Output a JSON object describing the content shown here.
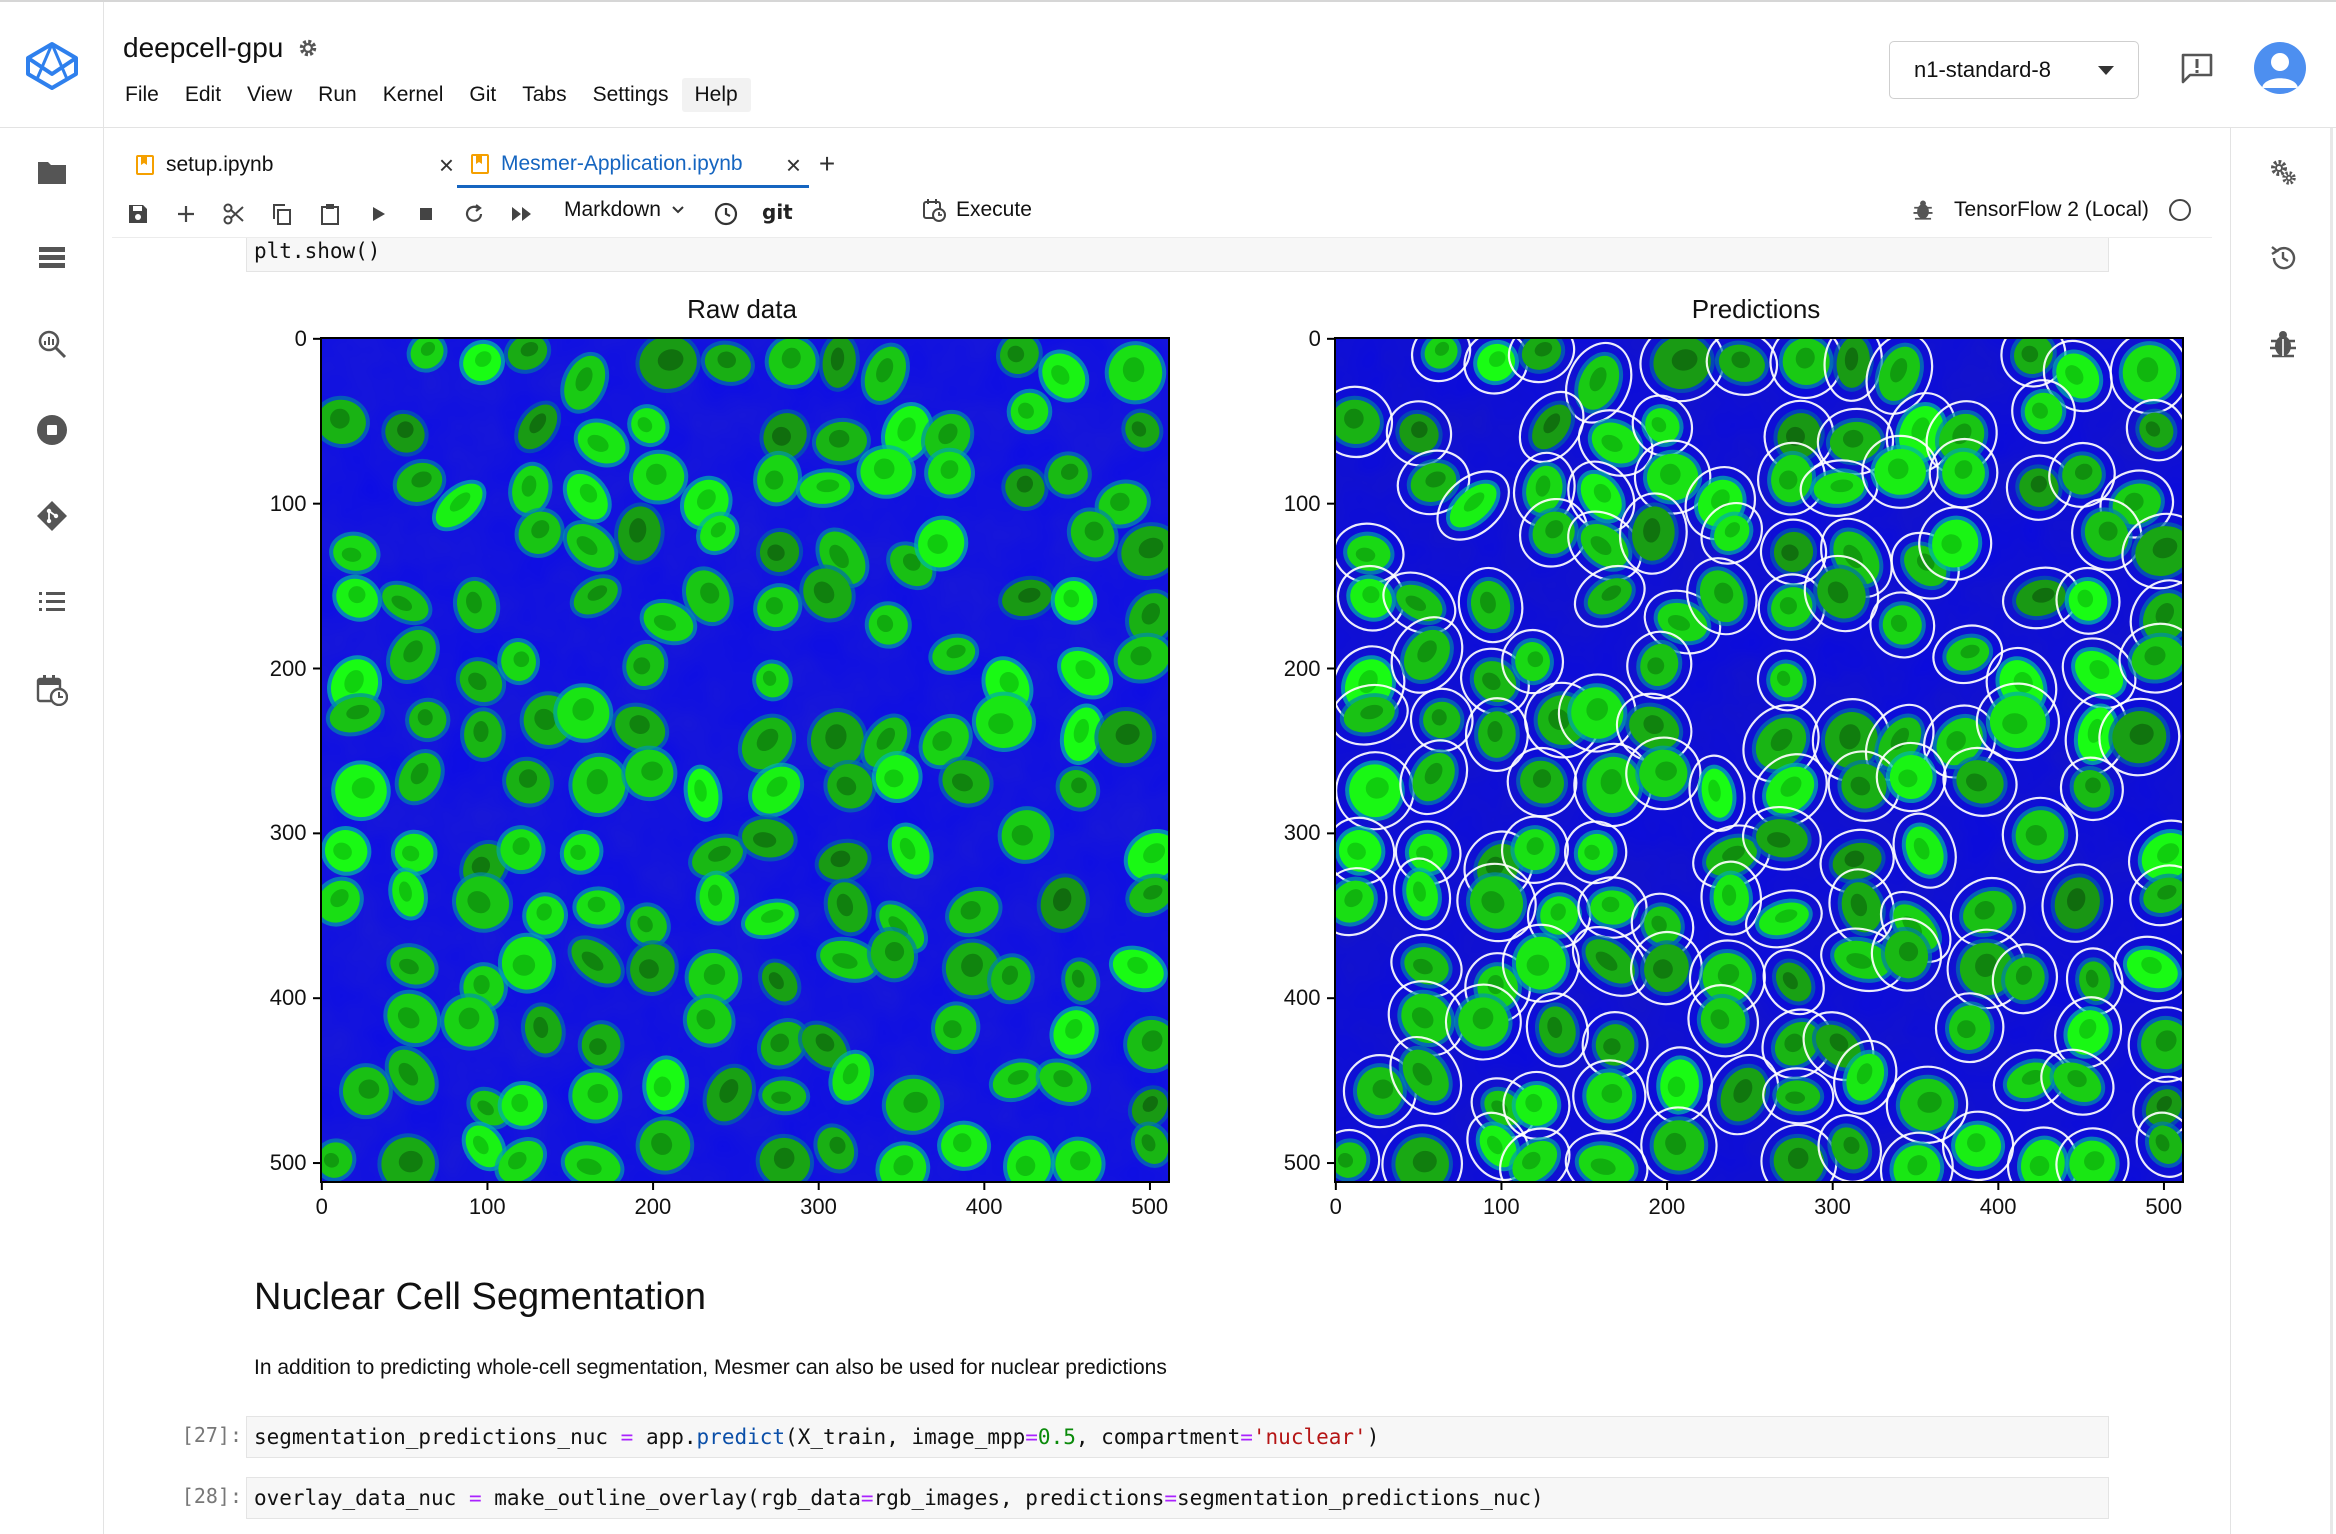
{
  "app": {
    "notebook_title": "deepcell-gpu",
    "menu": [
      "File",
      "Edit",
      "View",
      "Run",
      "Kernel",
      "Git",
      "Tabs",
      "Settings",
      "Help"
    ],
    "machine_type": "n1-standard-8"
  },
  "tabs": [
    {
      "label": "setup.ipynb",
      "active": false
    },
    {
      "label": "Mesmer-Application.ipynb",
      "active": true
    }
  ],
  "toolbar": {
    "cell_type": "Markdown",
    "git_label": "git",
    "execute_label": "Execute",
    "kernel_name": "TensorFlow 2 (Local)"
  },
  "left_sidebar_icons": [
    "folder-icon",
    "list-icon",
    "search-zoom-icon",
    "stop-circle-icon",
    "git-icon",
    "toc-icon",
    "calendar-clock-icon"
  ],
  "right_sidebar_icons": [
    "gears-icon",
    "history-icon",
    "bug-icon"
  ],
  "cells": {
    "top_code": "plt.show()",
    "plot_titles": [
      "Raw data",
      "Predictions"
    ],
    "x_ticks": [
      "0",
      "100",
      "200",
      "300",
      "400",
      "500"
    ],
    "y_ticks": [
      "0",
      "100",
      "200",
      "300",
      "400",
      "500"
    ],
    "md_heading": "Nuclear Cell Segmentation",
    "md_paragraph": "In addition to predicting whole-cell segmentation, Mesmer can also be used for nuclear predictions",
    "cell27": {
      "prompt": "[27]:",
      "code": "segmentation_predictions_nuc = app.predict(X_train, image_mpp=0.5, compartment='nuclear')"
    },
    "cell28": {
      "prompt": "[28]:",
      "code": "overlay_data_nuc = make_outline_overlay(rgb_data=rgb_images, predictions=segmentation_predictions_nuc)"
    }
  },
  "colors": {
    "accent": "#1565c0",
    "logo": "#2f80ed",
    "image_blue": "#1f1fcf",
    "image_green": "#22e012",
    "notebook_icon": "#f5a000"
  }
}
